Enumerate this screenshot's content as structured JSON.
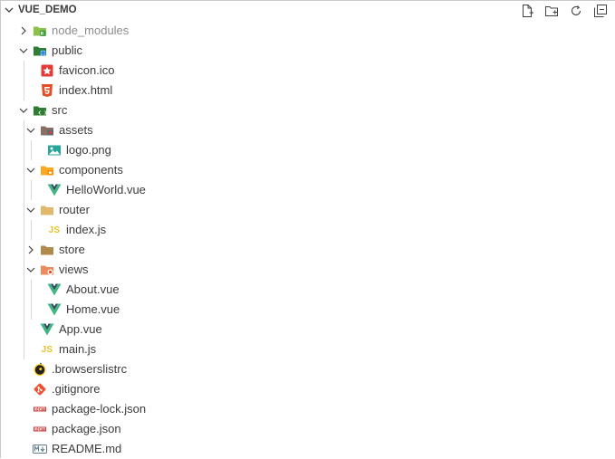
{
  "explorer": {
    "title": "VUE_DEMO",
    "actions": [
      {
        "name": "new-file-icon"
      },
      {
        "name": "new-folder-icon"
      },
      {
        "name": "refresh-icon"
      },
      {
        "name": "collapse-all-icon"
      }
    ]
  },
  "tree": [
    {
      "label": "node_modules",
      "depth": 1,
      "type": "folder",
      "icon": "node-folder-icon",
      "twisty": "collapsed",
      "muted": true
    },
    {
      "label": "public",
      "depth": 1,
      "type": "folder",
      "icon": "public-folder-icon",
      "twisty": "expanded"
    },
    {
      "label": "favicon.ico",
      "depth": 2,
      "type": "file",
      "icon": "favicon-icon"
    },
    {
      "label": "index.html",
      "depth": 2,
      "type": "file",
      "icon": "html5-icon"
    },
    {
      "label": "src",
      "depth": 1,
      "type": "folder",
      "icon": "src-folder-icon",
      "twisty": "expanded"
    },
    {
      "label": "assets",
      "depth": 2,
      "type": "folder",
      "icon": "assets-folder-icon",
      "twisty": "expanded"
    },
    {
      "label": "logo.png",
      "depth": 3,
      "type": "file",
      "icon": "image-icon"
    },
    {
      "label": "components",
      "depth": 2,
      "type": "folder",
      "icon": "components-folder-icon",
      "twisty": "expanded"
    },
    {
      "label": "HelloWorld.vue",
      "depth": 3,
      "type": "file",
      "icon": "vue-icon"
    },
    {
      "label": "router",
      "depth": 2,
      "type": "folder",
      "icon": "router-folder-icon",
      "twisty": "expanded"
    },
    {
      "label": "index.js",
      "depth": 3,
      "type": "file",
      "icon": "js-icon"
    },
    {
      "label": "store",
      "depth": 2,
      "type": "folder",
      "icon": "store-folder-icon",
      "twisty": "collapsed"
    },
    {
      "label": "views",
      "depth": 2,
      "type": "folder",
      "icon": "views-folder-icon",
      "twisty": "expanded"
    },
    {
      "label": "About.vue",
      "depth": 3,
      "type": "file",
      "icon": "vue-icon"
    },
    {
      "label": "Home.vue",
      "depth": 3,
      "type": "file",
      "icon": "vue-icon"
    },
    {
      "label": "App.vue",
      "depth": 2,
      "type": "file",
      "icon": "vue-icon"
    },
    {
      "label": "main.js",
      "depth": 2,
      "type": "file",
      "icon": "js-icon"
    },
    {
      "label": ".browserslistrc",
      "depth": 1,
      "type": "file",
      "icon": "browserslist-icon"
    },
    {
      "label": ".gitignore",
      "depth": 1,
      "type": "file",
      "icon": "git-icon"
    },
    {
      "label": "package-lock.json",
      "depth": 1,
      "type": "file",
      "icon": "npm-icon"
    },
    {
      "label": "package.json",
      "depth": 1,
      "type": "file",
      "icon": "npm-icon"
    },
    {
      "label": "README.md",
      "depth": 1,
      "type": "file",
      "icon": "markdown-icon"
    }
  ],
  "js_icon_text": "JS",
  "colors": {
    "vue_green": "#41b883",
    "vue_dark": "#35495e",
    "folder_green": "#2e8b57",
    "html_orange": "#e44d26",
    "js_yellow": "#e8c12a",
    "npm_red": "#cb3837",
    "git_red": "#f05032"
  }
}
